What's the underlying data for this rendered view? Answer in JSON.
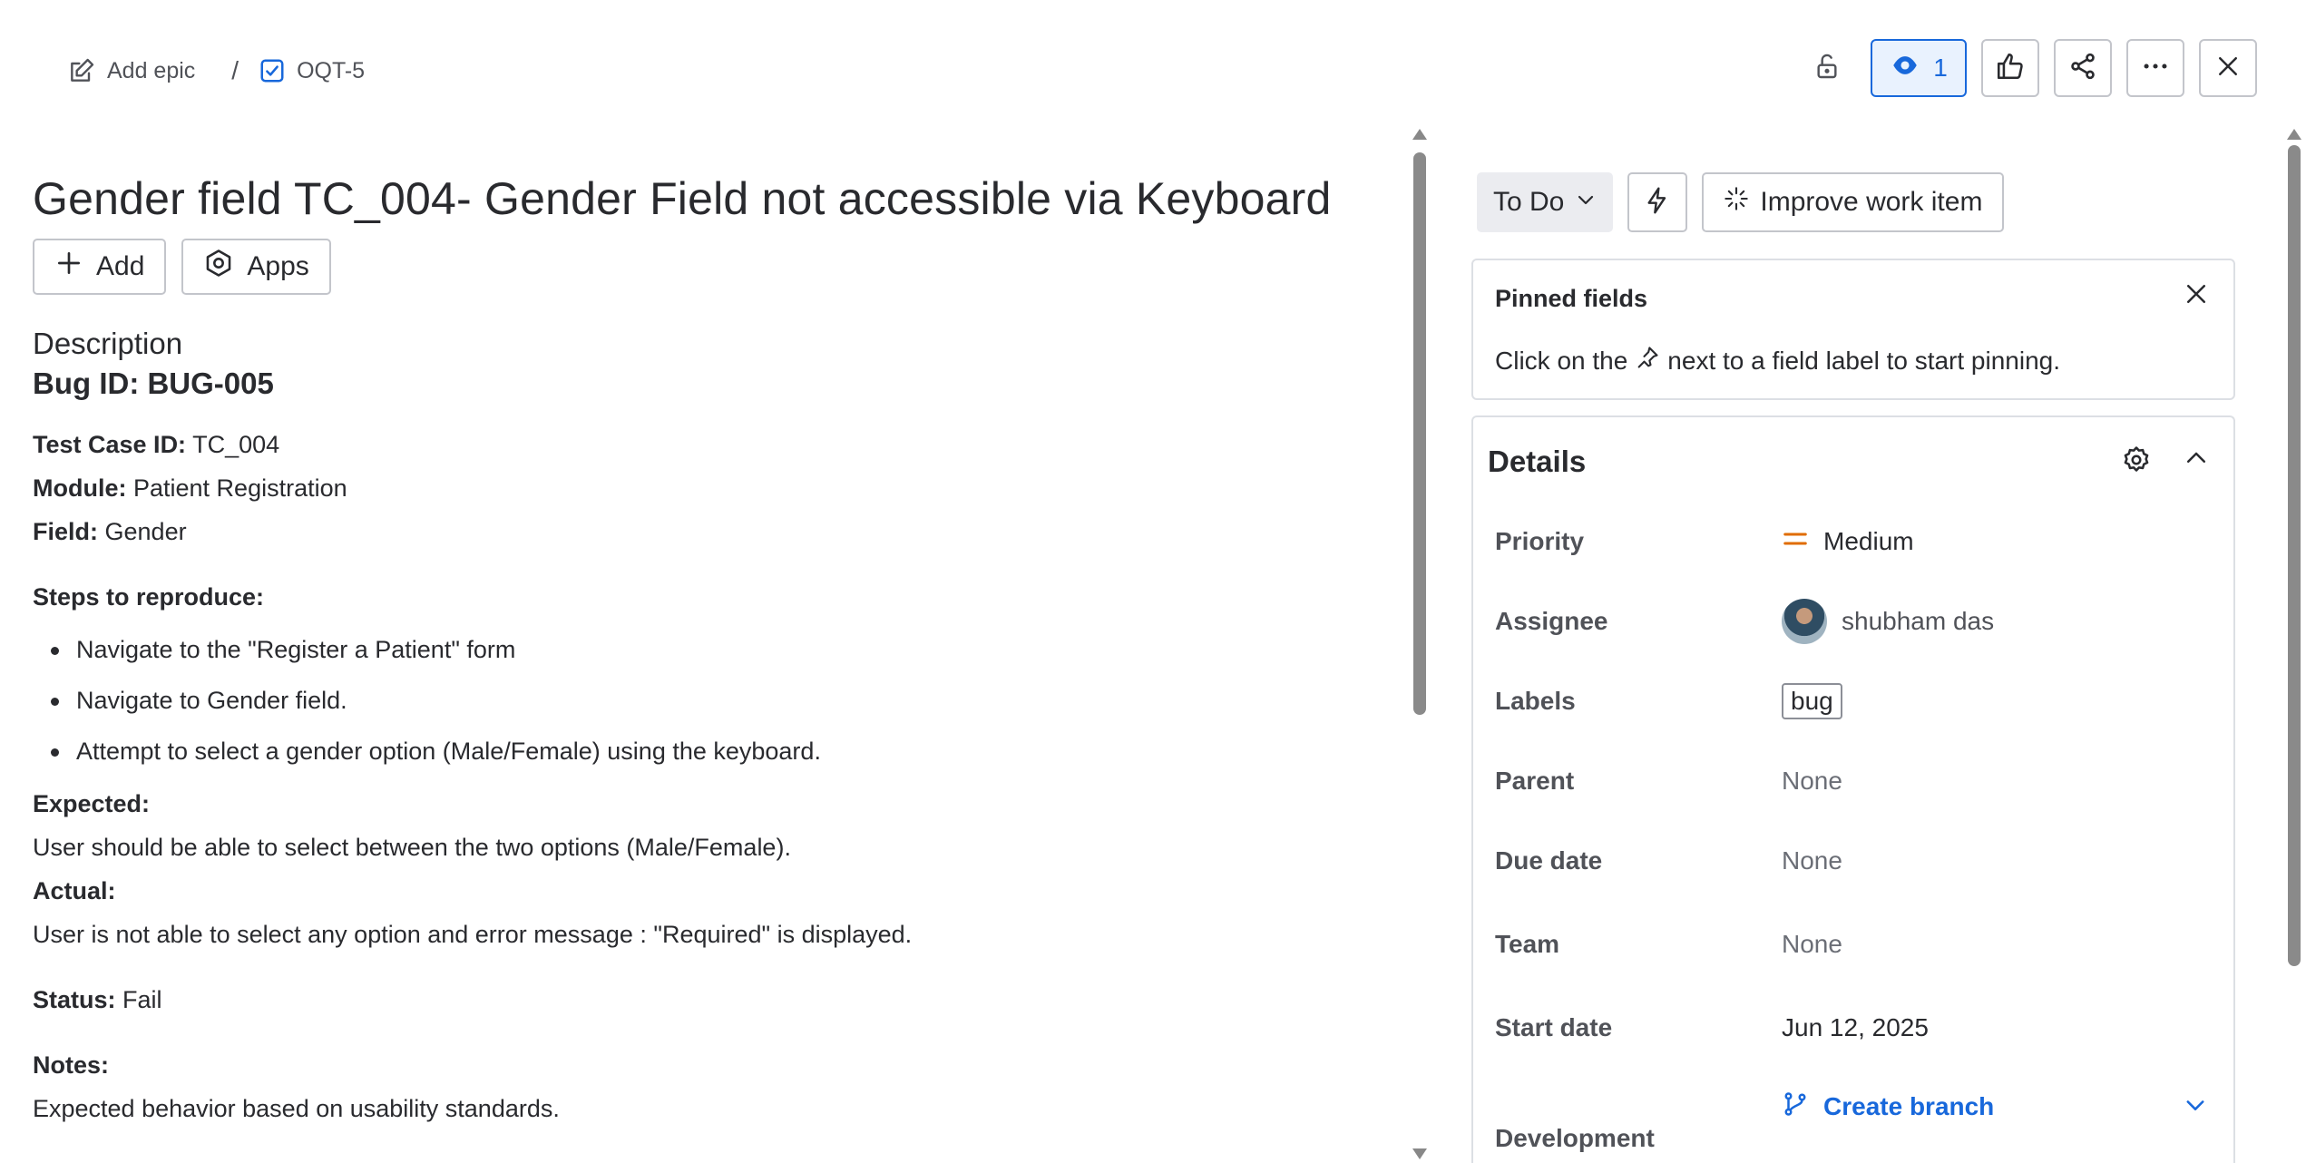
{
  "breadcrumb": {
    "epic_label": "Add epic",
    "separator": "/",
    "issue_key": "OQT-5"
  },
  "header_actions": {
    "watch_count": "1"
  },
  "issue": {
    "title_part1": "Gender field TC_004- Gender Field not accessible via Keyboard",
    "add_label": "Add",
    "apps_label": "Apps"
  },
  "description": {
    "heading": "Description",
    "bug_id": "Bug ID: BUG-005",
    "test_case_label": "Test Case ID:",
    "test_case_value": "TC_004",
    "module_label": "Module:",
    "module_value": "Patient Registration",
    "field_label": "Field:",
    "field_value": "Gender",
    "steps_heading": "Steps to reproduce:",
    "steps": [
      "Navigate to the \"Register a Patient\" form",
      "Navigate to Gender field.",
      "Attempt to select a gender option (Male/Female) using the keyboard."
    ],
    "expected_label": "Expected:",
    "expected_text": "User should be able to select between the two options (Male/Female).",
    "actual_label": "Actual:",
    "actual_text": "User is not able to select any option and error message : \"Required\" is displayed.",
    "status_label": "Status:",
    "status_value": "Fail",
    "notes_label": "Notes:",
    "notes_text": "Expected behavior based on usability standards."
  },
  "sidebar": {
    "status": "To Do",
    "improve_label": "Improve work item",
    "pinned_title": "Pinned fields",
    "pinned_text_before": "Click on the",
    "pinned_text_after": "next to a field label to start pinning.",
    "details_title": "Details",
    "fields": {
      "priority_label": "Priority",
      "priority_value": "Medium",
      "assignee_label": "Assignee",
      "assignee_value": "shubham das",
      "labels_label": "Labels",
      "labels_value": "bug",
      "parent_label": "Parent",
      "parent_value": "None",
      "due_label": "Due date",
      "due_value": "None",
      "team_label": "Team",
      "team_value": "None",
      "start_label": "Start date",
      "start_value": "Jun 12, 2025",
      "dev_label": "Development",
      "dev_value": "Create branch"
    }
  },
  "colors": {
    "accent": "#1868db",
    "priority_medium": "#e06c00",
    "text": "#292a2e",
    "muted": "#6b6e76"
  }
}
